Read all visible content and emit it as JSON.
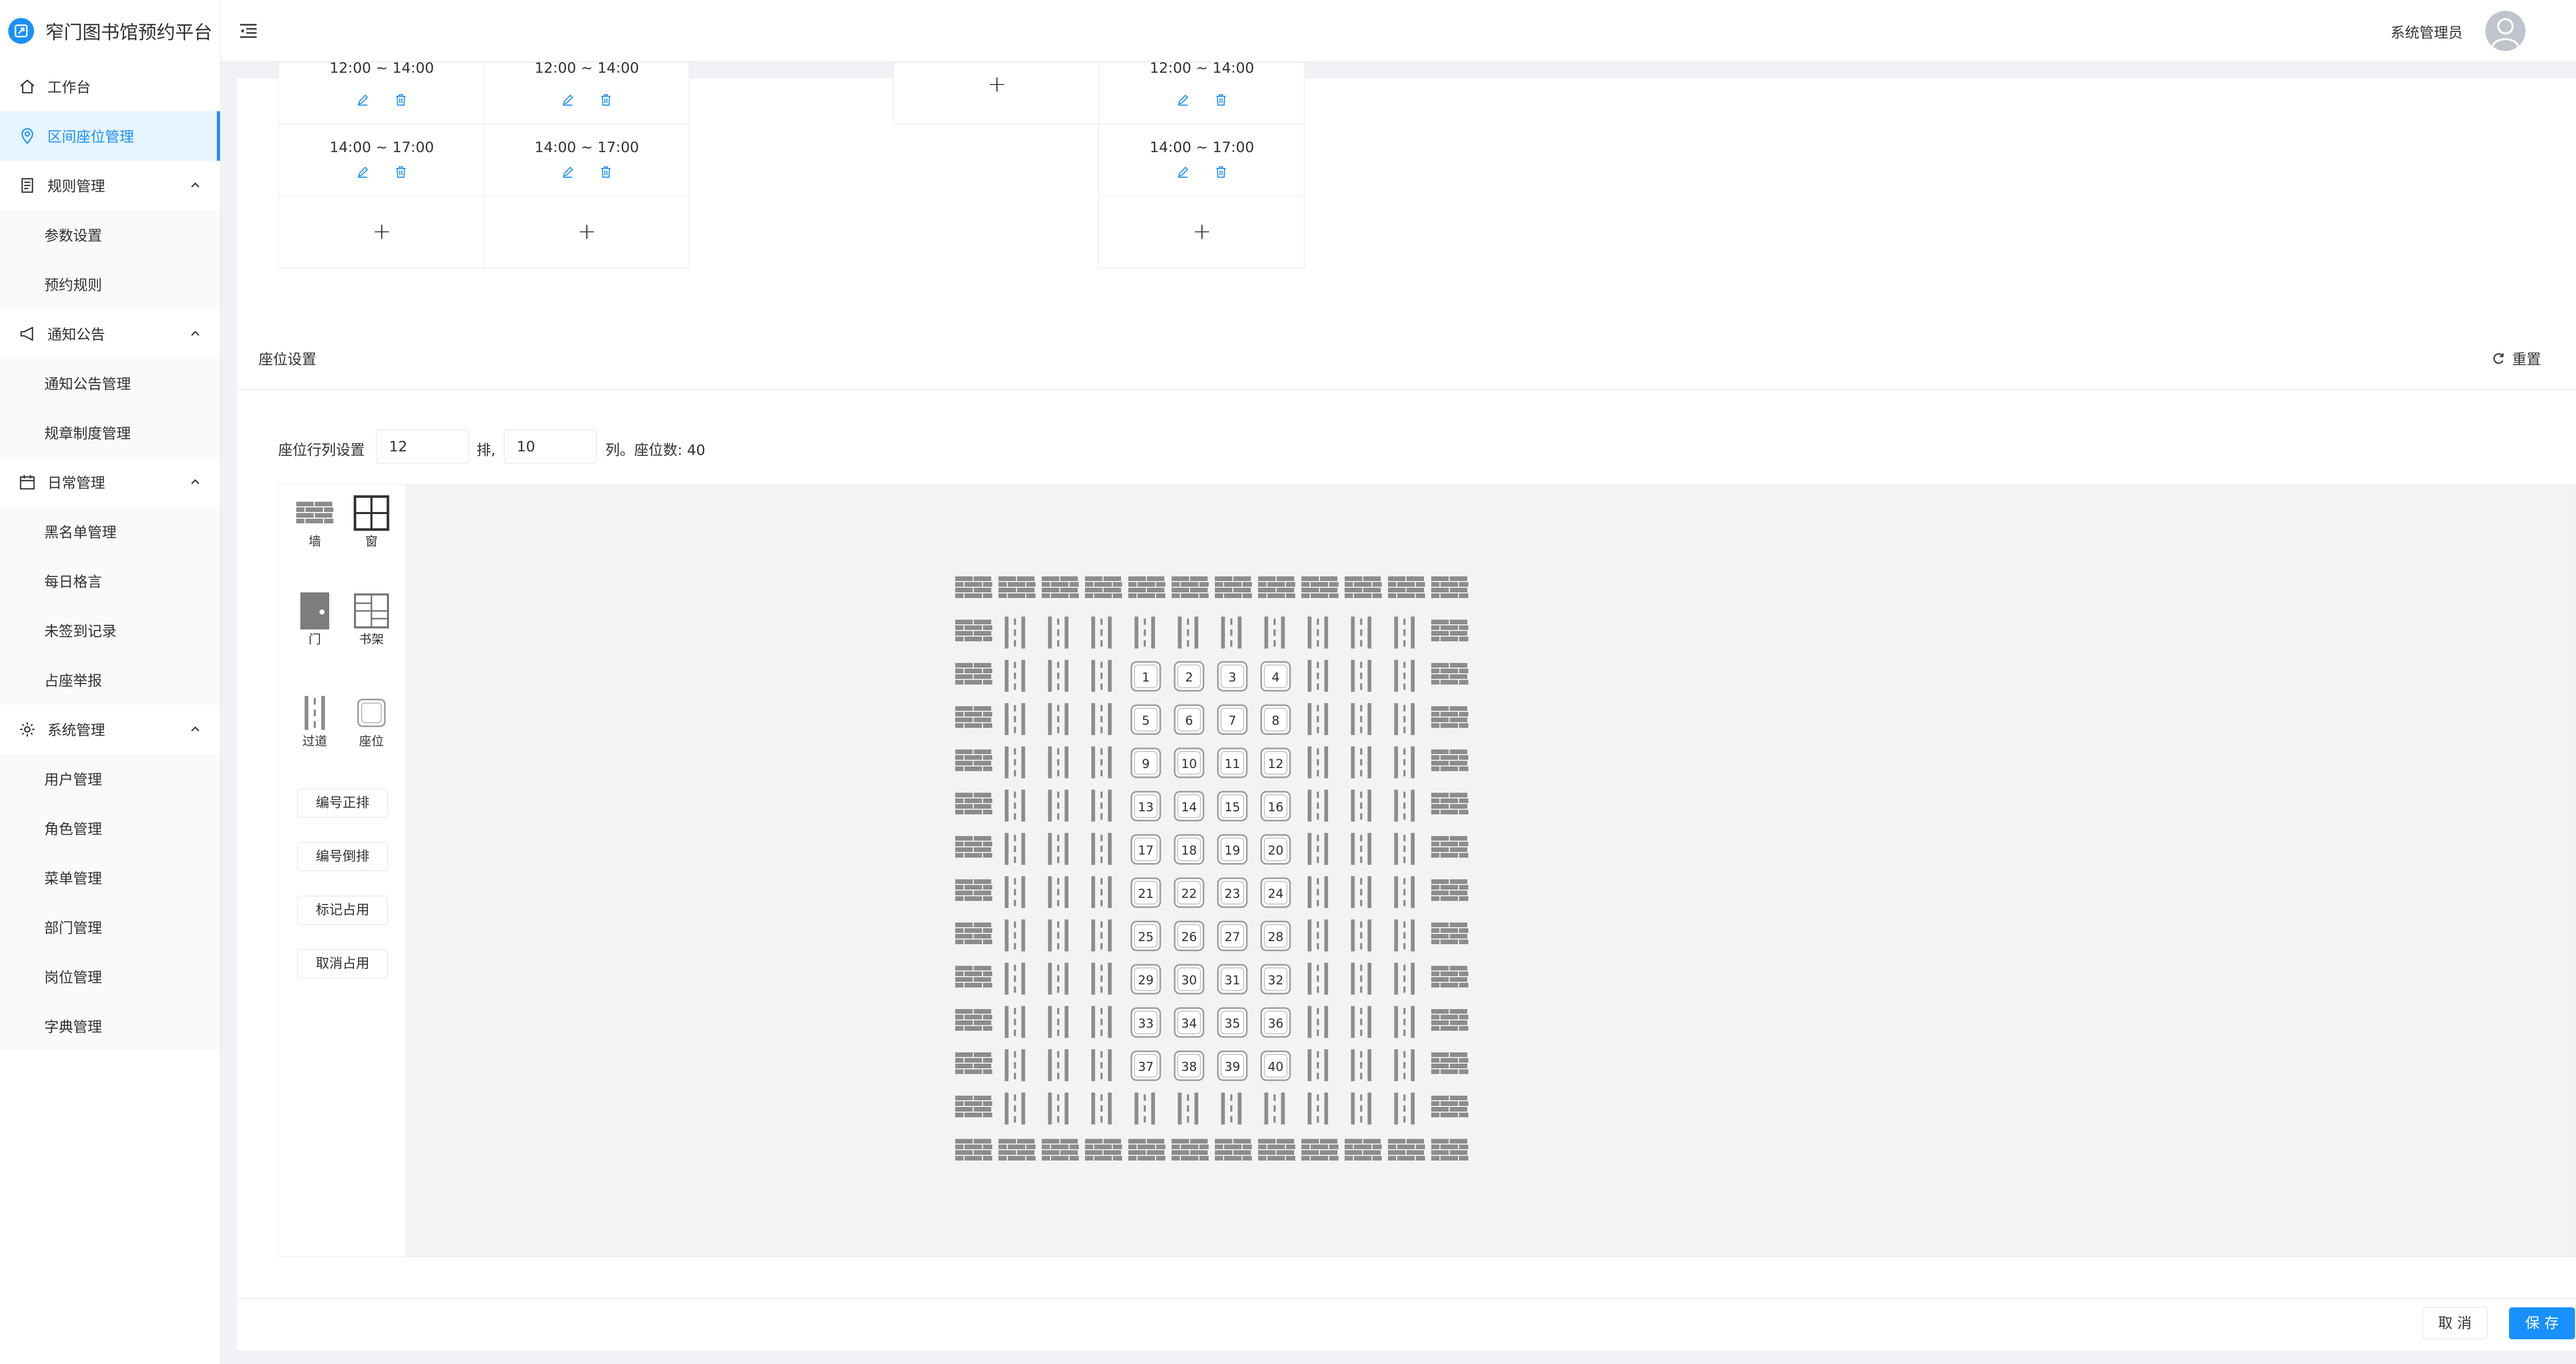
{
  "app": {
    "title": "窄门图书馆预约平台"
  },
  "header": {
    "user": "系统管理员"
  },
  "sidebar": {
    "items": [
      {
        "label": "工作台",
        "icon": "home-icon"
      },
      {
        "label": "区间座位管理",
        "icon": "location-icon",
        "active": true
      },
      {
        "label": "规则管理",
        "icon": "document-icon",
        "children": [
          "参数设置",
          "预约规则"
        ]
      },
      {
        "label": "通知公告",
        "icon": "megaphone-icon",
        "children": [
          "通知公告管理",
          "规章制度管理"
        ]
      },
      {
        "label": "日常管理",
        "icon": "calendar-icon",
        "children": [
          "黑名单管理",
          "每日格言",
          "未签到记录",
          "占座举报"
        ]
      },
      {
        "label": "系统管理",
        "icon": "gear-icon",
        "children": [
          "用户管理",
          "角色管理",
          "菜单管理",
          "部门管理",
          "岗位管理",
          "字典管理"
        ]
      }
    ]
  },
  "schedule": {
    "partial_slot": "12:00 ~ 14:00",
    "slot": "14:00 ~ 17:00",
    "add_symbol": "+"
  },
  "seat_settings": {
    "title": "座位设置",
    "reset": "重置",
    "rowcol_label": "座位行列设置",
    "rows": "12",
    "rows_unit": "排,",
    "cols": "10",
    "count_text": "列。座位数: 40"
  },
  "palette": {
    "wall": "墙",
    "window": "窗",
    "door": "门",
    "bookshelf": "书架",
    "aisle": "过道",
    "seat": "座位",
    "buttons": [
      "编号正排",
      "编号倒排",
      "标记占用",
      "取消占用"
    ]
  },
  "seat_grid": {
    "rows": 14,
    "cols": 12,
    "seat_rows": [
      2,
      3,
      4,
      5,
      6,
      7,
      8,
      9,
      10,
      11
    ],
    "seat_cols": [
      4,
      5,
      6,
      7
    ],
    "seat_numbers": [
      "1",
      "2",
      "3",
      "4",
      "5",
      "6",
      "7",
      "8",
      "9",
      "10",
      "11",
      "12",
      "13",
      "14",
      "15",
      "16",
      "17",
      "18",
      "19",
      "20",
      "21",
      "22",
      "23",
      "24",
      "25",
      "26",
      "27",
      "28",
      "29",
      "30",
      "31",
      "32",
      "33",
      "34",
      "35",
      "36",
      "37",
      "38",
      "39",
      "40"
    ],
    "colors": {
      "wall": "#8c8c8c",
      "aisle": "#8c8c8c",
      "seat_border": "#999999"
    }
  },
  "footer": {
    "cancel": "取 消",
    "save": "保 存"
  },
  "colors": {
    "primary": "#1890ff",
    "active_bg": "#e6f4ff"
  }
}
